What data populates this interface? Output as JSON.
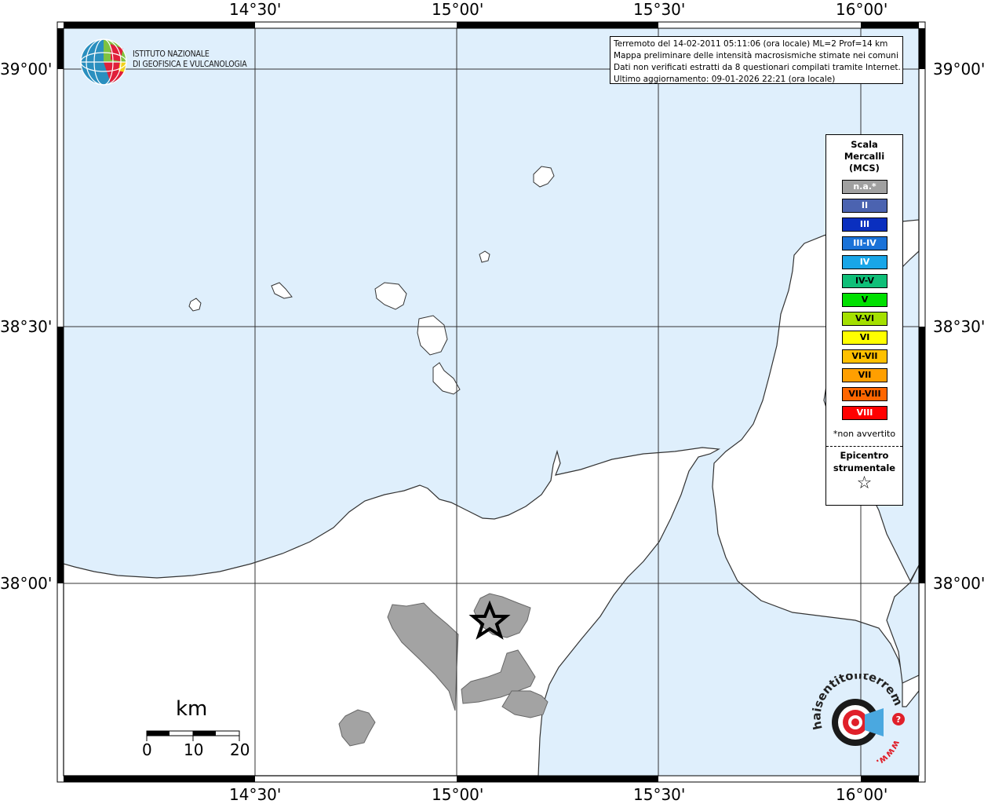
{
  "map": {
    "lon_labels": [
      "14°30'",
      "15°00'",
      "15°30'",
      "16°00'"
    ],
    "lat_labels": [
      "39°00'",
      "38°30'",
      "38°00'"
    ],
    "colors": {
      "sea": "#dfeffc",
      "land": "#ffffff",
      "affected_municipality": "#a3a3a3",
      "grid": "#000000"
    }
  },
  "logo": {
    "line1": "ISTITUTO NAZIONALE",
    "line2": "DI GEOFISICA E VULCANOLOGIA"
  },
  "info_box": {
    "line1": "Terremoto del 14-02-2011 05:11:06 (ora locale) ML=2 Prof=14 km",
    "line2": "Mappa preliminare delle intensità macrosismiche stimate nei comuni",
    "line3": "Dati non verificati estratti da 8 questionari compilati tramite Internet.",
    "line4": "Ultimo aggiornamento: 09-01-2026 22:21 (ora locale)"
  },
  "legend": {
    "title_line1": "Scala",
    "title_line2": "Mercalli",
    "title_line3": "(MCS)",
    "items": [
      {
        "label": "n.a.*",
        "color": "#a0a0a0"
      },
      {
        "label": "II",
        "color": "#4b63b0"
      },
      {
        "label": "III",
        "color": "#0a2fbf"
      },
      {
        "label": "III-IV",
        "color": "#1a72d8"
      },
      {
        "label": "IV",
        "color": "#19a6e8"
      },
      {
        "label": "IV-V",
        "color": "#0fbf78"
      },
      {
        "label": "V",
        "color": "#00e000"
      },
      {
        "label": "V-VI",
        "color": "#a4e000"
      },
      {
        "label": "VI",
        "color": "#ffff00"
      },
      {
        "label": "VI-VII",
        "color": "#ffc000"
      },
      {
        "label": "VII",
        "color": "#ff9f00"
      },
      {
        "label": "VII-VIII",
        "color": "#ff6600"
      },
      {
        "label": "VIII",
        "color": "#ff0000"
      }
    ],
    "note": "*non avvertito",
    "epicenter_line1": "Epicentro",
    "epicenter_line2": "strumentale",
    "epicenter_symbol": "☆"
  },
  "scale_bar": {
    "unit": "km",
    "ticks": [
      "0",
      "10",
      "20"
    ]
  },
  "hst_logo": {
    "main_text": "haisentitoilterremoto.it",
    "www_text": "www."
  }
}
